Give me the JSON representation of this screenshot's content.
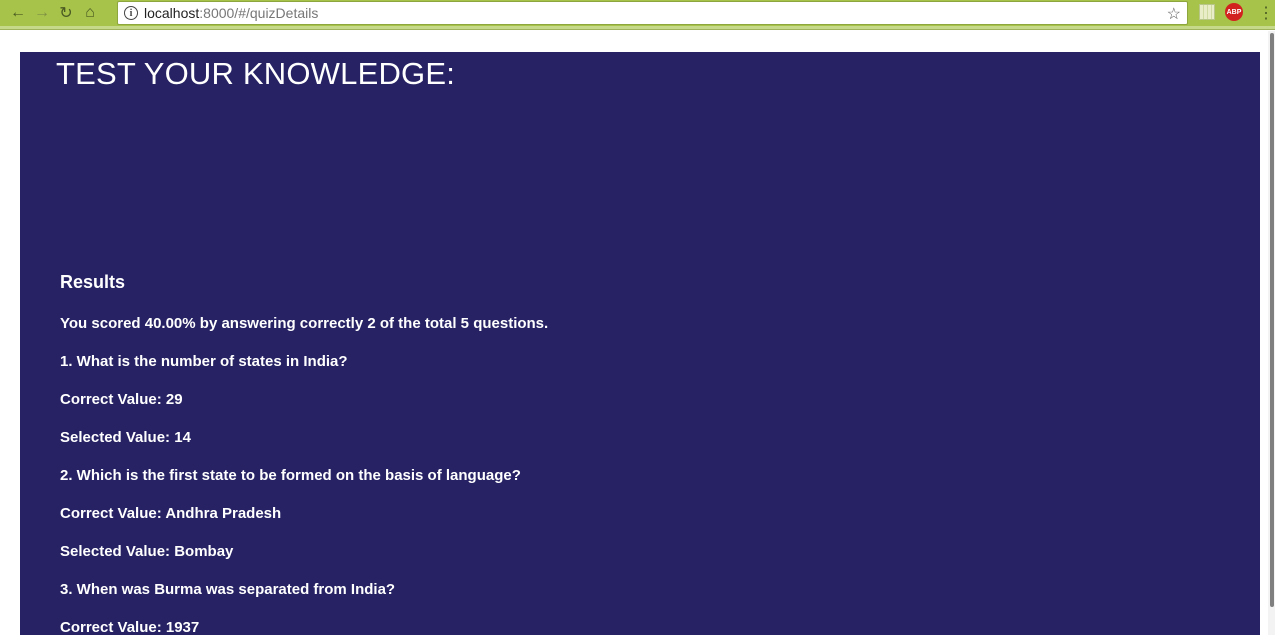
{
  "browser": {
    "url_host": "localhost",
    "url_path": ":8000/#/quizDetails",
    "ext_abp_label": "ABP"
  },
  "page": {
    "title": "TEST YOUR KNOWLEDGE:",
    "results_heading": "Results",
    "score_text": "You scored 40.00% by answering correctly 2 of the total 5 questions."
  },
  "results": [
    {
      "question": "1. What is the number of states in India?",
      "correct": "Correct Value: 29",
      "selected": "Selected Value: 14"
    },
    {
      "question": "2. Which is the first state to be formed on the basis of language?",
      "correct": "Correct Value: Andhra Pradesh",
      "selected": "Selected Value: Bombay"
    },
    {
      "question": "3. When was Burma was separated from India?",
      "correct": "Correct Value: 1937"
    }
  ]
}
